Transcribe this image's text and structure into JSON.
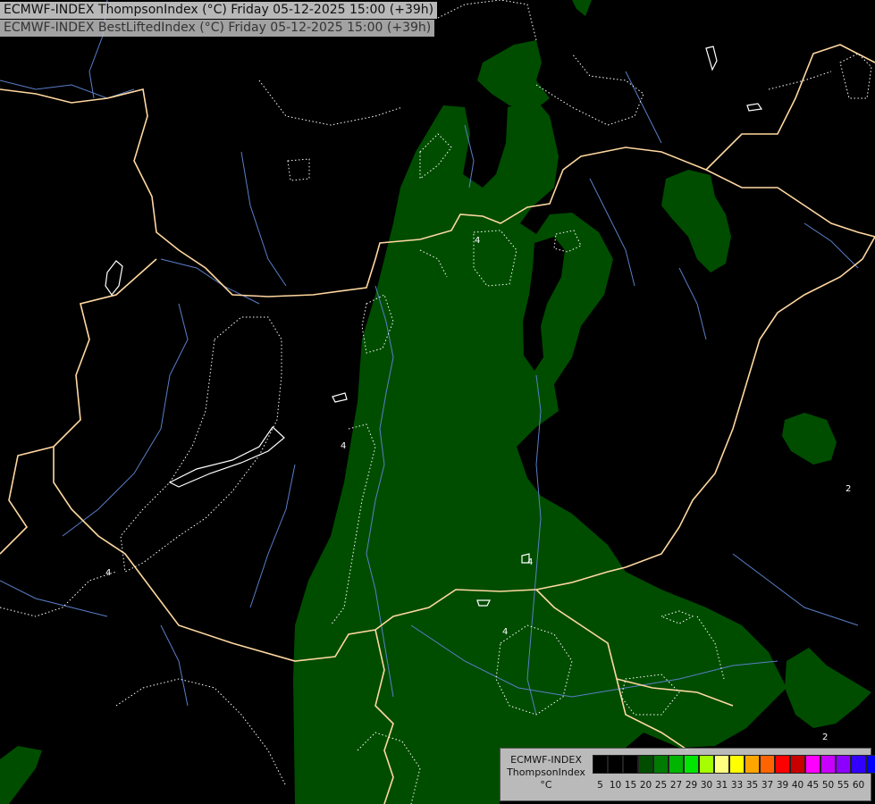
{
  "titles": {
    "line1": "ECMWF-INDEX ThompsonIndex (°C) Friday 05-12-2025 15:00 (+39h)",
    "line2": "ECMWF-INDEX BestLiftedIndex (°C) Friday 05-12-2025 15:00 (+39h)"
  },
  "legend": {
    "title": "ECMWF-INDEX",
    "subtitle": "ThompsonIndex",
    "unit": "°C",
    "classes": [
      {
        "label": "5",
        "color": "#000000"
      },
      {
        "label": "10",
        "color": "#000000"
      },
      {
        "label": "15",
        "color": "#000000"
      },
      {
        "label": "20",
        "color": "#004d00"
      },
      {
        "label": "25",
        "color": "#007a00"
      },
      {
        "label": "27",
        "color": "#00b400"
      },
      {
        "label": "29",
        "color": "#00e600"
      },
      {
        "label": "30",
        "color": "#a5ff00"
      },
      {
        "label": "31",
        "color": "#ffff80"
      },
      {
        "label": "33",
        "color": "#ffff00"
      },
      {
        "label": "35",
        "color": "#ffa500"
      },
      {
        "label": "37",
        "color": "#ff6400"
      },
      {
        "label": "39",
        "color": "#ff0000"
      },
      {
        "label": "40",
        "color": "#c80000"
      },
      {
        "label": "45",
        "color": "#ff00ff"
      },
      {
        "label": "50",
        "color": "#c800ff"
      },
      {
        "label": "55",
        "color": "#8c00ff"
      },
      {
        "label": "60",
        "color": "#3200ff"
      },
      {
        "label": "",
        "color": "#0000ff"
      }
    ]
  },
  "map": {
    "background_color": "#000000",
    "index_fill_color": "#004d00",
    "border_color": "#ffd8a0",
    "river_color": "#5a7ec8",
    "contour_color": "#ffffff",
    "contour_labels": [
      "4",
      "4",
      "4",
      "4",
      "4",
      "2",
      "2"
    ]
  }
}
